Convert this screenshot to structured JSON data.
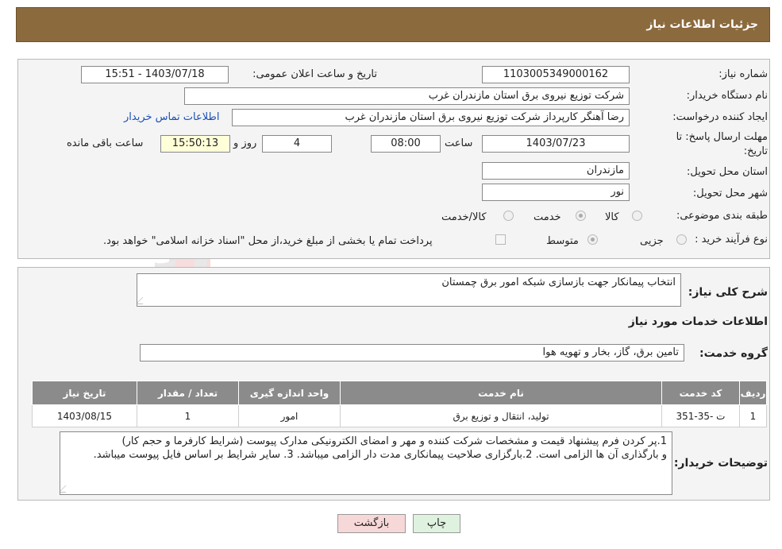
{
  "header": {
    "title": "جزئیات اطلاعات نیاز"
  },
  "form": {
    "need_number_label": "شماره نیاز:",
    "need_number": "1103005349000162",
    "announce_label": "تاریخ و ساعت اعلان عمومی:",
    "announce_value": "1403/07/18 - 15:51",
    "buyer_org_label": "نام دستگاه خریدار:",
    "buyer_org": "شرکت توزیع نیروی برق استان مازندران غرب",
    "creator_label": "ایجاد کننده درخواست:",
    "creator": "رضا آهنگر کارپرداز شرکت توزیع نیروی برق استان مازندران غرب",
    "contact_link": "اطلاعات تماس خریدار",
    "deadline_label_1": "مهلت ارسال پاسخ: تا",
    "deadline_label_2": "تاریخ:",
    "deadline_date": "1403/07/23",
    "time_label": "ساعت",
    "deadline_time": "08:00",
    "days_value": "4",
    "days_label": "روز و",
    "remaining_time": "15:50:13",
    "remaining_label": "ساعت باقی مانده",
    "province_label": "استان محل تحویل:",
    "province": "مازندران",
    "city_label": "شهر محل تحویل:",
    "city": "نور",
    "category_label": "طبقه بندی موضوعی:",
    "category_options": [
      "کالا",
      "خدمت",
      "کالا/خدمت"
    ],
    "category_selected": "خدمت",
    "process_label": "نوع فرآیند خرید :",
    "process_options": [
      "جزیی",
      "متوسط"
    ],
    "payment_note": "پرداخت تمام یا بخشی از مبلغ خرید،از محل \"اسناد خزانه اسلامی\" خواهد بود."
  },
  "details": {
    "summary_label": "شرح کلی نیاز:",
    "summary": "انتخاب پیمانکار جهت بازسازی شبکه امور برق چمستان",
    "services_title": "اطلاعات خدمات مورد نیاز",
    "service_group_label": "گروه خدمت:",
    "service_group": "تامین برق، گاز، بخار و تهویه هوا",
    "table": {
      "headers": [
        "ردیف",
        "کد خدمت",
        "نام خدمت",
        "واحد اندازه گیری",
        "تعداد / مقدار",
        "تاریخ نیاز"
      ],
      "rows": [
        [
          "1",
          "ت -35-351",
          "تولید، انتقال و توزیع برق",
          "امور",
          "1",
          "1403/08/15"
        ]
      ]
    },
    "buyer_notes_label": "توضیحات خریدار:",
    "buyer_notes_1": "1.پر کردن فرم پیشنهاد قیمت و مشخصات شرکت کننده و مهر و امضای الکترونیکی مدارک پیوست (شرایط کارفرما و حجم کار)",
    "buyer_notes_2": "و بارگذاری آن ها الزامی است. 2.بارگزاری صلاحیت پیمانکاری مدت دار الزامی میباشد. 3. سایر شرایط بر اساس فایل پیوست میباشد."
  },
  "buttons": {
    "print": "چاپ",
    "back": "بازگشت"
  },
  "colors": {
    "header": "#8b6a3e",
    "table_header": "#8b8b8b",
    "link": "#1a4fb5"
  }
}
